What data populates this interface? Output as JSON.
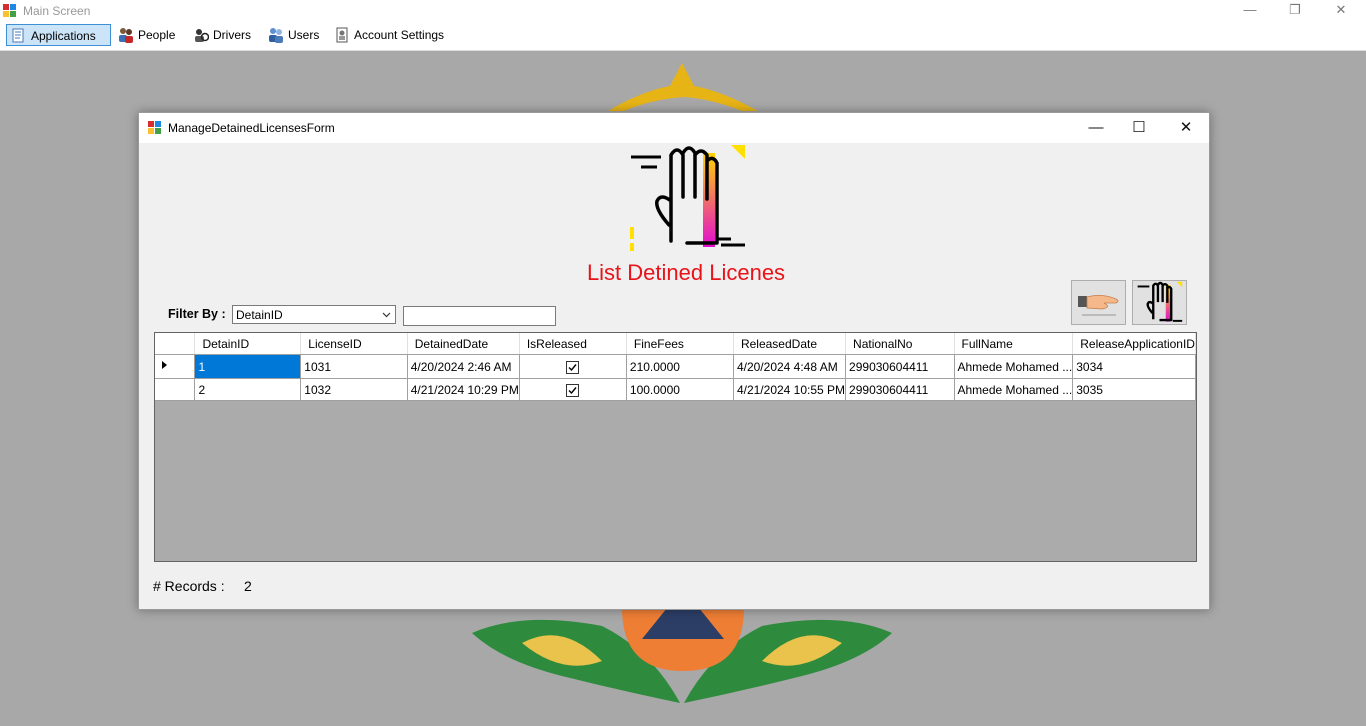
{
  "main_window": {
    "title": "Main Screen",
    "controls": {
      "minimize": "—",
      "restore": "❐",
      "close": "✕"
    }
  },
  "menu": {
    "items": [
      {
        "label": "Applications",
        "icon": "applications-icon",
        "active": true
      },
      {
        "label": "People",
        "icon": "people-icon"
      },
      {
        "label": "Drivers",
        "icon": "drivers-icon"
      },
      {
        "label": "Users",
        "icon": "users-icon"
      },
      {
        "label": "Account Settings",
        "icon": "account-settings-icon"
      }
    ]
  },
  "dialog": {
    "title": "ManageDetainedLicensesForm",
    "controls": {
      "minimize": "—",
      "maximize": "☐",
      "close": "✕"
    },
    "heading": "List Detined Licenes",
    "heading_color": "#e8141a",
    "filter": {
      "label": "Filter By :",
      "selected": "DetainID",
      "value": ""
    },
    "buttons": {
      "release_icon": "release-hand-icon",
      "detain_icon": "detain-hand-icon"
    },
    "grid": {
      "columns": [
        "DetainID",
        "LicenseID",
        "DetainedDate",
        "IsReleased",
        "FineFees",
        "ReleasedDate",
        "NationalNo",
        "FullName",
        "ReleaseApplicationID"
      ],
      "rows": [
        {
          "DetainID": "1",
          "LicenseID": "1031",
          "DetainedDate": "4/20/2024 2:46 AM",
          "IsReleased": true,
          "FineFees": "210.0000",
          "ReleasedDate": "4/20/2024 4:48 AM",
          "NationalNo": "299030604411",
          "FullName": "Ahmede Mohamed ...",
          "ReleaseApplicationID": "3034"
        },
        {
          "DetainID": "2",
          "LicenseID": "1032",
          "DetainedDate": "4/21/2024 10:29 PM",
          "IsReleased": true,
          "FineFees": "100.0000",
          "ReleasedDate": "4/21/2024 10:55 PM",
          "NationalNo": "299030604411",
          "FullName": "Ahmede Mohamed ...",
          "ReleaseApplicationID": "3035"
        }
      ]
    },
    "records": {
      "label": "# Records :",
      "count": "2"
    }
  }
}
